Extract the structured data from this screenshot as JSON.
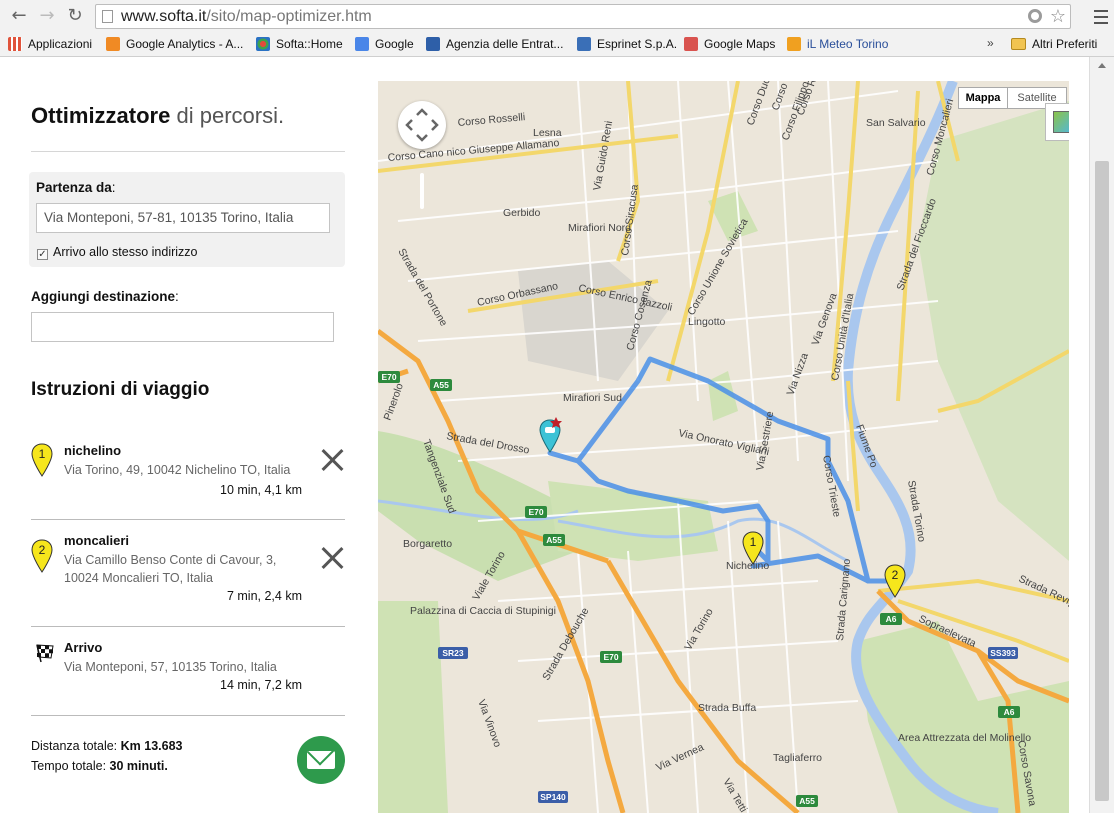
{
  "browser": {
    "url_host": "www.softa.it",
    "url_path": "/sito/map-optimizer.htm",
    "bookmarks": [
      {
        "label": "Applicazioni",
        "icon": "apps-grid-icon",
        "color": "#e0533b"
      },
      {
        "label": "Google Analytics - A...",
        "icon": "google-analytics-icon",
        "color": "#f08a24"
      },
      {
        "label": "Softa::Home",
        "icon": "softa-icon",
        "color": "#e24b3b"
      },
      {
        "label": "Google",
        "icon": "google-icon",
        "color": "#4a86e8"
      },
      {
        "label": "Agenzia delle Entrat...",
        "icon": "agenzia-entrate-icon",
        "color": "#2e5fa8"
      },
      {
        "label": "Esprinet S.p.A.",
        "icon": "esprinet-icon",
        "color": "#3a6fb7"
      },
      {
        "label": "Google Maps",
        "icon": "google-maps-icon",
        "color": "#d9534f"
      },
      {
        "label": "iL Meteo Torino",
        "icon": "ilmeteo-icon",
        "color": "#f0a020"
      }
    ],
    "more_label": "»",
    "other_bookmarks": "Altri Preferiti"
  },
  "sidebar": {
    "title_bold": "Ottimizzatore",
    "title_rest": "di percorsi.",
    "start_label": "Partenza da",
    "start_value": "Via Monteponi, 57-81, 10135 Torino, Italia",
    "same_address_label": "Arrivo allo stesso indirizzo",
    "same_address_checked": true,
    "add_dest_label": "Aggiungi destinazione",
    "add_dest_value": "",
    "instructions_title": "Istruzioni di viaggio",
    "steps": [
      {
        "marker": "1",
        "name": "nichelino",
        "address": "Via Torino, 49, 10042 Nichelino TO, Italia",
        "summary": "10 min, 4,1 km"
      },
      {
        "marker": "2",
        "name": "moncalieri",
        "address": "Via Camillo Benso Conte di Cavour, 3, 10024 Moncalieri TO, Italia",
        "summary": "7 min, 2,4 km"
      }
    ],
    "arrival": {
      "name": "Arrivo",
      "address": "Via Monteponi, 57, 10135 Torino, Italia",
      "summary": "14 min, 7,2 km"
    },
    "total_distance_label": "Distanza totale:",
    "total_distance_value": "Km 13.683",
    "total_time_label": "Tempo totale:",
    "total_time_value": "30 minuti."
  },
  "map": {
    "type_map": "Mappa",
    "type_satellite": "Satellite",
    "route_color": "#4a90e8",
    "labels": [
      "Corso Rosselli",
      "Lesna",
      "Corso Cano nico Giuseppe Allamano",
      "Via Guido Reni",
      "Gerbido",
      "Mirafiori Nord",
      "Corso Siracusa",
      "Corso Orbassano",
      "Corso Enrico Tazzoli",
      "Corso Cosenza",
      "Corso Unione Sovietica",
      "Lingotto",
      "Strada del Portone",
      "Mirafiori Sud",
      "Via Onorato Vigliani",
      "Strada del Drosso",
      "Pinerolo",
      "Tangenziale Sud",
      "Borgaretto",
      "Viale Torino",
      "Nichelino",
      "Via Sestriere",
      "Corso Trieste",
      "Fiume Po",
      "Strada Torino",
      "Palazzina di Caccia di Stupinigi",
      "Strada Debouche",
      "Via Torino",
      "Strada Buffa",
      "Via Vinovo",
      "Via Vernea",
      "Tagliaferro",
      "Area Attrezzata del Molinello",
      "Sopraelevata",
      "Strada Revigliasco",
      "Corso Savona",
      "Strada Carignano",
      "San Salvario",
      "Corso Moncalieri",
      "Strada del Fioccardo",
      "Via Nizza",
      "Via Genova",
      "Corso Unità d'Italia",
      "Corso Filippo Turati",
      "Corso Galileo Ferraris",
      "Corso Re Umberto",
      "Corso Duca degli Abruzzi",
      "Via Tetti"
    ],
    "shields": [
      "E70",
      "A55",
      "E70",
      "A55",
      "E70",
      "A6",
      "SS393",
      "A6",
      "SR23",
      "SP140",
      "A55"
    ],
    "markers": [
      "1",
      "2"
    ]
  }
}
